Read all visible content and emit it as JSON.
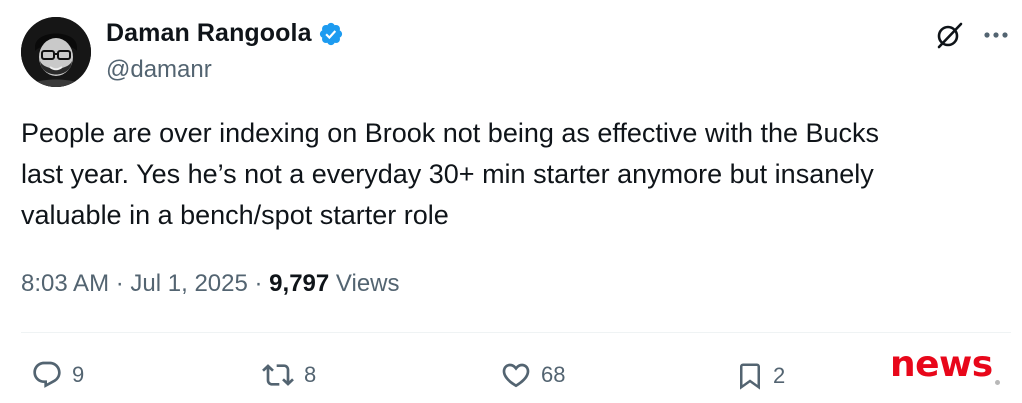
{
  "author": {
    "display_name": "Daman Rangoola",
    "handle": "@damanr",
    "verified": true,
    "verified_color": "#1d9bf0"
  },
  "tweet": {
    "text_lines": [
      "People are over indexing on Brook not being as effective with the Bucks",
      "last year. Yes he’s not a everyday 30+ min starter anymore but insanely",
      "valuable in a bench/spot starter role"
    ],
    "time": "8:03 AM",
    "separator": "·",
    "date": "Jul 1, 2025",
    "views_count": "9,797",
    "views_label": "Views"
  },
  "actions": {
    "replies": "9",
    "reposts": "8",
    "likes": "68",
    "bookmarks": "2"
  },
  "icons": {
    "grok": "grok-icon",
    "more": "more-options-icon",
    "reply": "reply-icon",
    "repost": "repost-icon",
    "like": "heart-icon",
    "bookmark": "bookmark-icon"
  },
  "watermark": {
    "text": "news",
    "color": "#e8071a"
  },
  "colors": {
    "text_primary": "#0f1419",
    "text_secondary": "#536471",
    "divider": "#eff3f4"
  }
}
